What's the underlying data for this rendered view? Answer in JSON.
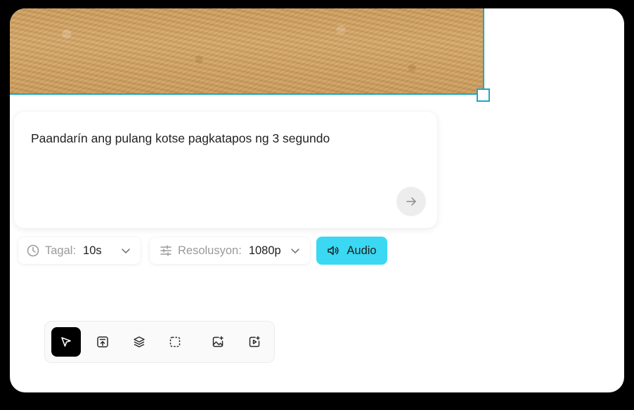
{
  "prompt": {
    "text": "Paandarín ang pulang kotse pagkatapos ng 3 segundo",
    "send_icon": "arrow-right-icon"
  },
  "options": {
    "duration": {
      "label": "Tagal:",
      "value": "10s",
      "icon": "clock-icon"
    },
    "resolution": {
      "label": "Resolusyon:",
      "value": "1080p",
      "icon": "sliders-icon"
    },
    "audio": {
      "label": "Audio",
      "icon": "speaker-icon",
      "color": "#3ad8f2"
    }
  },
  "toolbar": {
    "tools": [
      {
        "icon": "cursor-arrow-icon",
        "active": true
      },
      {
        "icon": "upload-frame-icon",
        "active": false
      },
      {
        "icon": "layers-icon",
        "active": false
      },
      {
        "icon": "dashed-selection-icon",
        "active": false
      },
      {
        "icon": "image-sparkle-icon",
        "active": false
      },
      {
        "icon": "video-sparkle-icon",
        "active": false
      }
    ]
  },
  "colors": {
    "selection": "#1ea7c3",
    "accent": "#3ad8f2"
  }
}
